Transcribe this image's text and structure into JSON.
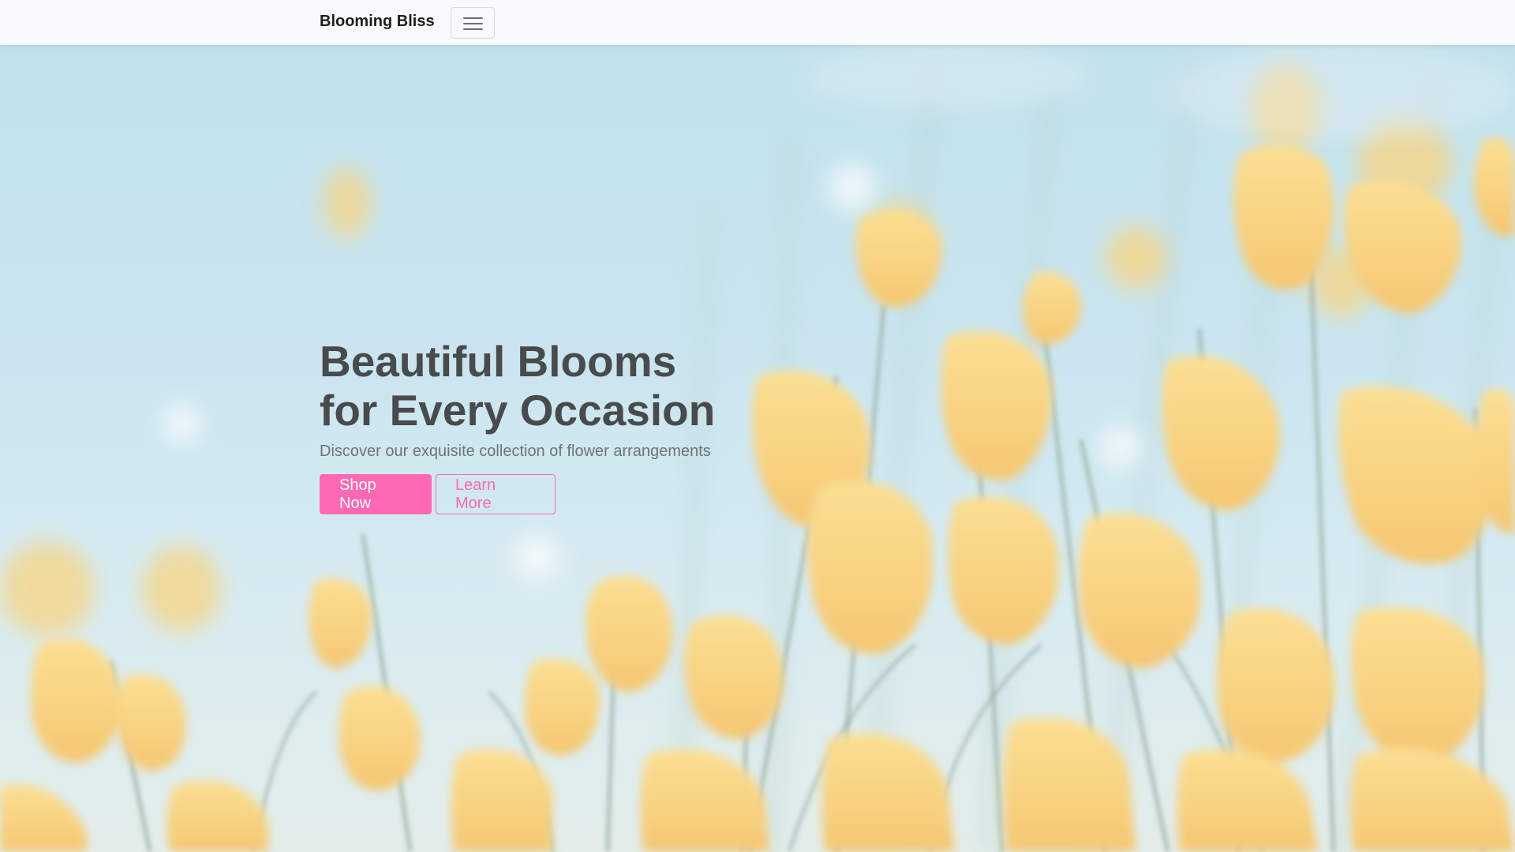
{
  "navbar": {
    "brand": "Blooming Bliss",
    "toggle_icon": "hamburger-menu-icon"
  },
  "hero": {
    "title_line1": "Beautiful Blooms",
    "title_line2": "for Every Occasion",
    "subtitle": "Discover our exquisite collection of flower arrangements",
    "primary_button": "Shop Now",
    "secondary_button": "Learn More",
    "background_image": "yellow-poppy-field-photo"
  },
  "colors": {
    "accent": "#ff69b4",
    "navbar_bg": "#f8fafc",
    "heading": "#494a4b",
    "subtitle": "#6f7375",
    "flowers": "#f7c24a",
    "sky": "#a9d6e6"
  }
}
